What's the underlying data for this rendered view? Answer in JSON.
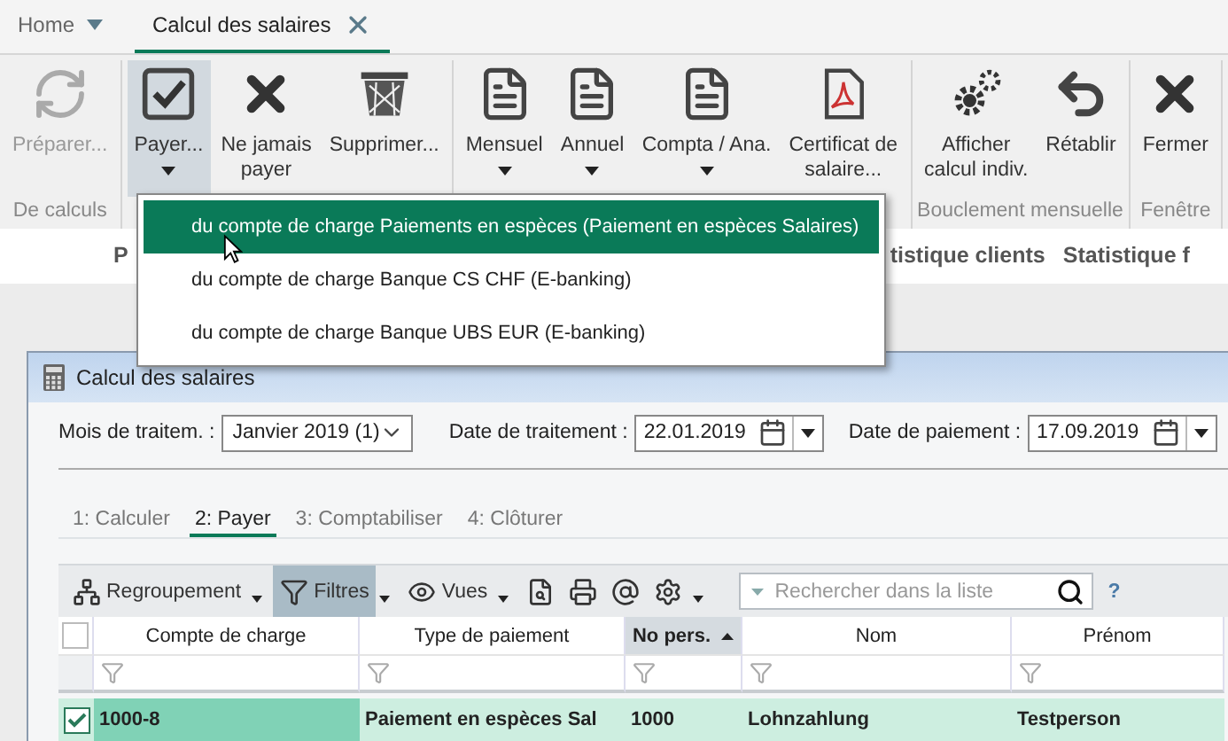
{
  "tabs": [
    {
      "label": "Home",
      "selected": false,
      "kind": "menu"
    },
    {
      "label": "Calcul des salaires",
      "selected": true,
      "kind": "closable"
    }
  ],
  "ribbon": {
    "groups": [
      {
        "label": "De calculs",
        "buttons": [
          {
            "label": "Préparer...",
            "kind": "refresh",
            "disabled": true,
            "active": false,
            "dropdown": false
          }
        ]
      },
      {
        "buttons": [
          {
            "label": "Payer...",
            "kind": "check",
            "disabled": false,
            "active": true,
            "dropdown": true
          },
          {
            "label": "Ne jamais\npayer",
            "kind": "cross",
            "disabled": false,
            "active": false,
            "dropdown": false
          },
          {
            "label": "Supprimer...",
            "kind": "basket",
            "disabled": false,
            "active": false,
            "dropdown": false
          }
        ]
      },
      {
        "buttons": [
          {
            "label": "Mensuel",
            "kind": "doc",
            "disabled": false,
            "active": false,
            "dropdown": true
          },
          {
            "label": "Annuel",
            "kind": "doc",
            "disabled": false,
            "active": false,
            "dropdown": true
          },
          {
            "label": "Compta / Ana.",
            "kind": "doc",
            "disabled": false,
            "active": false,
            "dropdown": true
          },
          {
            "label": "Certificat de\nsalaire...",
            "kind": "pdf",
            "disabled": false,
            "active": false,
            "dropdown": false
          }
        ]
      },
      {
        "label": "Bouclement mensuelle",
        "buttons": [
          {
            "label": "Afficher\ncalcul indiv.",
            "kind": "gears",
            "disabled": false,
            "active": false,
            "dropdown": false
          },
          {
            "label": "Rétablir",
            "kind": "undo",
            "disabled": false,
            "active": false,
            "dropdown": false
          }
        ]
      },
      {
        "label": "Fenêtre",
        "buttons": [
          {
            "label": "Fermer",
            "kind": "cross",
            "disabled": false,
            "active": false,
            "dropdown": false
          }
        ]
      }
    ]
  },
  "menu": {
    "items": [
      {
        "label": "du compte de charge Paiements en espèces (Paiement en espèces Salaires)",
        "selected": true
      },
      {
        "label": "du compte de charge Banque CS CHF (E-banking)",
        "selected": false
      },
      {
        "label": "du compte de charge Banque UBS EUR (E-banking)",
        "selected": false
      }
    ]
  },
  "nav": {
    "items": [
      "P",
      "tistique clients",
      "Statistique f"
    ]
  },
  "window": {
    "title": "Calcul des salaires",
    "fields": [
      {
        "label": "Mois de traitem. :",
        "value": "Janvier 2019 (1)",
        "kind": "select"
      },
      {
        "label": "Date de traitement :",
        "value": "22.01.2019",
        "kind": "date"
      },
      {
        "label": "Date de paiement :",
        "value": "17.09.2019",
        "kind": "date"
      }
    ],
    "steps": [
      {
        "label": "1: Calculer",
        "selected": false
      },
      {
        "label": "2: Payer",
        "selected": true
      },
      {
        "label": "3: Comptabiliser",
        "selected": false
      },
      {
        "label": "4: Clôturer",
        "selected": false
      }
    ],
    "toolbar": {
      "items": [
        {
          "kind": "group",
          "label": "Regroupement",
          "active": false
        },
        {
          "kind": "filter",
          "label": "Filtres",
          "active": true
        },
        {
          "kind": "eye",
          "label": "Vues",
          "active": false
        },
        {
          "kind": "preview"
        },
        {
          "kind": "print"
        },
        {
          "kind": "mail"
        },
        {
          "kind": "gear"
        }
      ],
      "search": {
        "placeholder": "Rechercher dans la liste"
      },
      "help": "?"
    },
    "table": {
      "all_checked": false,
      "columns": [
        {
          "label": "Compte de charge",
          "sorted": false
        },
        {
          "label": "Type de paiement",
          "sorted": false
        },
        {
          "label": "No pers.",
          "sorted": true
        },
        {
          "label": "Nom",
          "sorted": false
        },
        {
          "label": "Prénom",
          "sorted": false
        }
      ],
      "rows": [
        {
          "checked": true,
          "selected": true,
          "cells": [
            "1000-8",
            "Paiement en espèces Sal",
            "1000",
            "Lohnzahlung",
            "Testperson"
          ]
        }
      ]
    }
  }
}
